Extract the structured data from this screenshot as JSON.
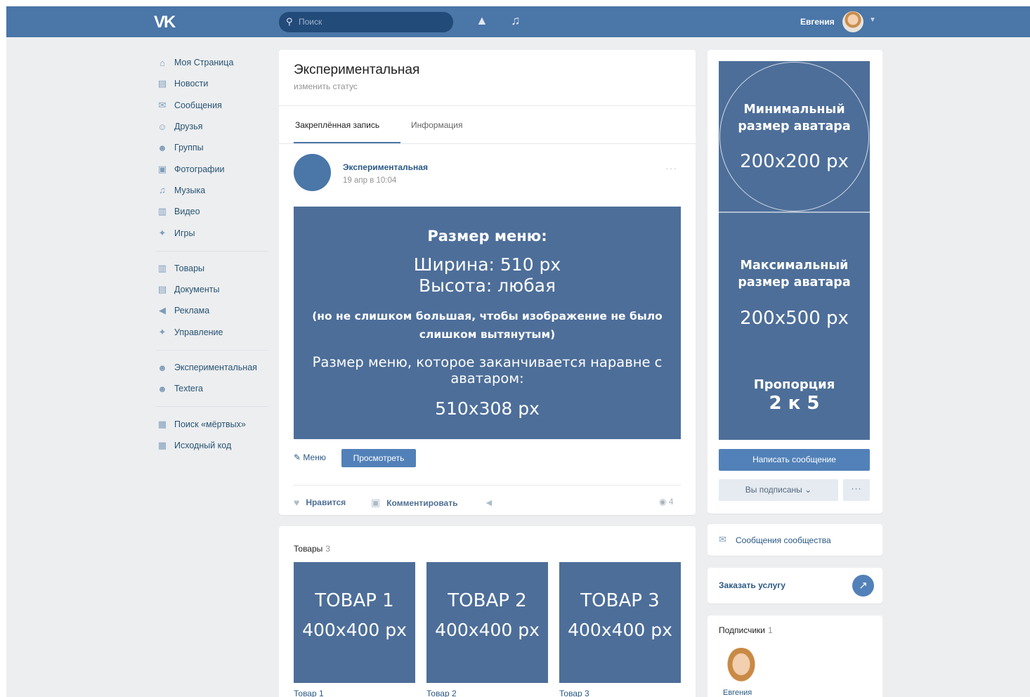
{
  "header": {
    "logo": "VK",
    "search_placeholder": "Поиск",
    "bell_icon": "bell-icon",
    "music_icon": "music-icon",
    "user_name": "Евгения"
  },
  "nav": {
    "items": [
      {
        "label": "Моя Страница",
        "icon": "home-icon",
        "glyph": "⌂"
      },
      {
        "label": "Новости",
        "icon": "news-icon",
        "glyph": "▤"
      },
      {
        "label": "Сообщения",
        "icon": "messages-icon",
        "glyph": "✉"
      },
      {
        "label": "Друзья",
        "icon": "friend-icon",
        "glyph": "☺"
      },
      {
        "label": "Группы",
        "icon": "groups-icon",
        "glyph": "☻"
      },
      {
        "label": "Фотографии",
        "icon": "camera-icon",
        "glyph": "▣"
      },
      {
        "label": "Музыка",
        "icon": "music-icon",
        "glyph": "♫"
      },
      {
        "label": "Видео",
        "icon": "video-icon",
        "glyph": "▥"
      },
      {
        "label": "Игры",
        "icon": "games-icon",
        "glyph": "✦"
      }
    ],
    "items2": [
      {
        "label": "Товары",
        "icon": "bag-icon",
        "glyph": "▥"
      },
      {
        "label": "Документы",
        "icon": "document-icon",
        "glyph": "▤"
      },
      {
        "label": "Реклама",
        "icon": "megaphone-icon",
        "glyph": "◀"
      },
      {
        "label": "Управление",
        "icon": "gamepad-icon",
        "glyph": "✦"
      }
    ],
    "items3": [
      {
        "label": "Экспериментальная",
        "icon": "group-icon",
        "glyph": "☻"
      },
      {
        "label": "Textera",
        "icon": "group-icon",
        "glyph": "☻"
      }
    ],
    "items4": [
      {
        "label": "Поиск «мёртвых»",
        "icon": "app-icon",
        "glyph": "▦"
      },
      {
        "label": "Исходный код",
        "icon": "app-icon",
        "glyph": "▦"
      }
    ]
  },
  "profile": {
    "name": "Экспериментальная",
    "status": "изменить статус",
    "tabs": [
      "Закреплённая запись",
      "Информация"
    ]
  },
  "post": {
    "author": "Экспериментальная",
    "date": "19 апр в 10:04",
    "more": "···",
    "menu_image": {
      "line1": "Размер меню:",
      "line2": "Ширина: 510 px",
      "line3": "Высота: любая",
      "line4": "(но не слишком большая, чтобы изображение не было слишком вытянутым)",
      "line5": "Размер меню, которое заканчивается наравне с аватаром:",
      "line6": "510x308 px"
    },
    "menu_link": "Меню",
    "view_button": "Просмотреть",
    "like": "Нравится",
    "comment": "Комментировать",
    "views": "4"
  },
  "goods": {
    "title": "Товары",
    "count": "3",
    "items": [
      {
        "name": "ТОВАР 1",
        "size": "400x400 px",
        "caption": "Товар 1"
      },
      {
        "name": "ТОВАР 2",
        "size": "400x400 px",
        "caption": "Товар 2"
      },
      {
        "name": "ТОВАР 3",
        "size": "400x400 px",
        "caption": "Товар 3"
      }
    ]
  },
  "sidebar": {
    "avatar": {
      "min_label": "Минимальный размер аватара",
      "min_size": "200x200 px",
      "max_label": "Максимальный размер аватара",
      "max_size": "200x500 px",
      "ratio_label": "Пропорция",
      "ratio_value": "2 к 5"
    },
    "write_button": "Написать сообщение",
    "subscribed_button": "Вы подписаны ⌄",
    "more_button": "···",
    "community_messages": "Сообщения сообщества",
    "order_service": "Заказать услугу",
    "subscribers_title": "Подписчики",
    "subscribers_count": "1",
    "subscriber_name": "Евгения"
  },
  "colors": {
    "brand": "#4a76a8",
    "button": "#5181b8",
    "image_fill": "#4d6e99",
    "background": "#edeef0"
  }
}
